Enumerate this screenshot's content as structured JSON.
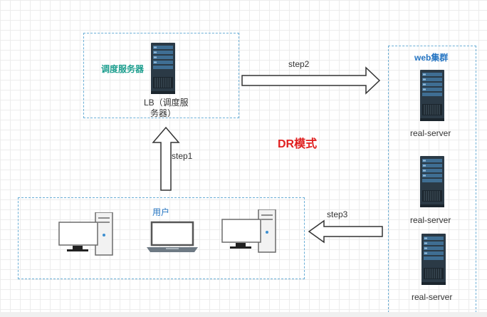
{
  "title": "DR模式",
  "scheduler": {
    "group_label": "调度服务器",
    "server_label_line1": "LB（调度服",
    "server_label_line2": "务器）"
  },
  "cluster": {
    "title": "web集群",
    "servers": [
      {
        "label": "real-server"
      },
      {
        "label": "real-server"
      },
      {
        "label": "real-server"
      }
    ]
  },
  "users": {
    "label": "用户"
  },
  "steps": {
    "step1": "step1",
    "step2": "step2",
    "step3": "step3"
  },
  "colors": {
    "dashed_border": "#6aaed6",
    "teal_label": "#1c9e8e",
    "blue_label": "#2474c2",
    "title_red": "#e02020",
    "server_body": "#2b3a46"
  },
  "icons": [
    "server-icon",
    "desktop-computer-icon",
    "laptop-icon",
    "arrow-right-icon",
    "arrow-up-icon",
    "arrow-left-icon"
  ]
}
